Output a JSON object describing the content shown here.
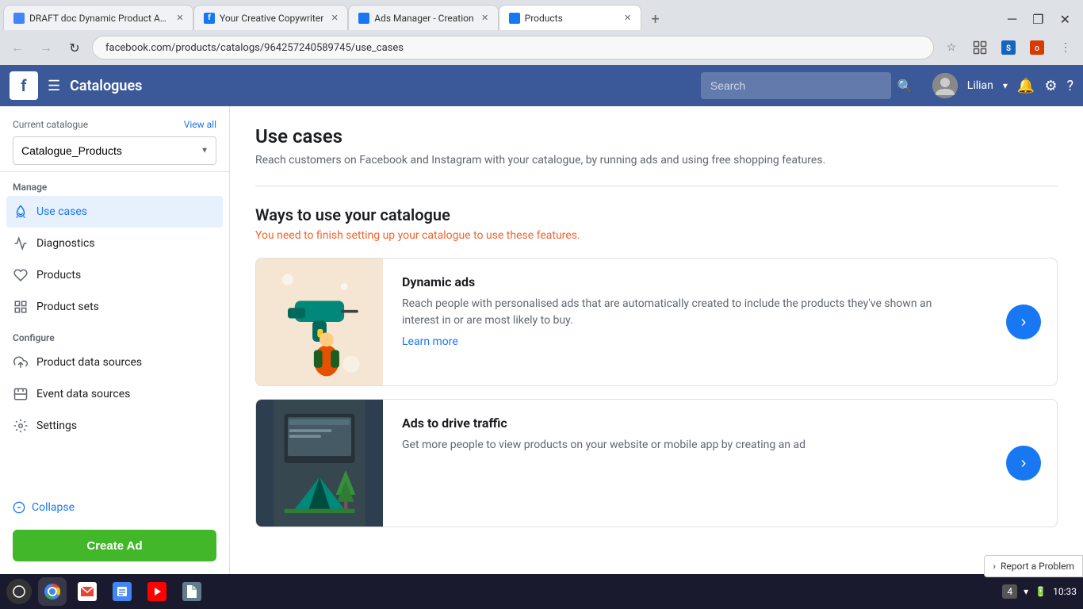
{
  "browser": {
    "tabs": [
      {
        "id": "tab1",
        "title": "DRAFT doc Dynamic Product Ad...",
        "favicon_type": "google-doc",
        "active": false,
        "closeable": true
      },
      {
        "id": "tab2",
        "title": "Your Creative Copywriter",
        "favicon_type": "fb",
        "active": false,
        "closeable": true
      },
      {
        "id": "tab3",
        "title": "Ads Manager - Creation",
        "favicon_type": "ads",
        "active": false,
        "closeable": true
      },
      {
        "id": "tab4",
        "title": "Products",
        "favicon_type": "products",
        "active": true,
        "closeable": true
      }
    ],
    "address": "facebook.com/products/catalogs/964257240589745/use_cases"
  },
  "header": {
    "app_name": "Catalogues",
    "search_placeholder": "Search",
    "user_name": "Lilian",
    "chevron": "▾"
  },
  "sidebar": {
    "current_catalogue_label": "Current catalogue",
    "view_all": "View all",
    "catalogue_name": "Catalogue_Products",
    "manage_label": "Manage",
    "nav_items": [
      {
        "id": "use-cases",
        "label": "Use cases",
        "icon": "rocket",
        "active": true
      },
      {
        "id": "diagnostics",
        "label": "Diagnostics",
        "icon": "diagnostics",
        "active": false
      },
      {
        "id": "products",
        "label": "Products",
        "icon": "products",
        "active": false
      },
      {
        "id": "product-sets",
        "label": "Product sets",
        "icon": "product-sets",
        "active": false
      }
    ],
    "configure_label": "Configure",
    "configure_items": [
      {
        "id": "product-data-sources",
        "label": "Product data sources",
        "icon": "upload"
      },
      {
        "id": "event-data-sources",
        "label": "Event data sources",
        "icon": "event"
      },
      {
        "id": "settings",
        "label": "Settings",
        "icon": "settings"
      }
    ],
    "collapse_label": "Collapse",
    "create_ad_label": "Create Ad"
  },
  "main": {
    "page_title": "Use cases",
    "page_subtitle": "Reach customers on Facebook and Instagram with your catalogue, by running ads and using free shopping features.",
    "ways_title": "Ways to use your catalogue",
    "ways_subtitle": "You need to finish setting up your catalogue to use these features.",
    "use_cases": [
      {
        "id": "dynamic-ads",
        "title": "Dynamic ads",
        "description": "Reach people with personalised ads that are automatically created to include the products they've shown an interest in or are most likely to buy.",
        "learn_more": "Learn more",
        "illustration": "drill"
      },
      {
        "id": "ads-to-drive-traffic",
        "title": "Ads to drive traffic",
        "description": "Get more people to view products on your website or mobile app by creating an ad",
        "learn_more": "",
        "illustration": "tent"
      }
    ]
  },
  "taskbar": {
    "time": "10:33",
    "battery_icon": "🔋",
    "wifi_icon": "▾",
    "notification": "4"
  },
  "report_problem": "Report a Problem"
}
